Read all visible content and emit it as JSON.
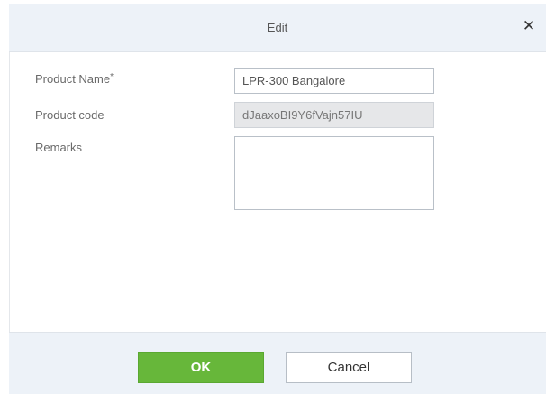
{
  "dialog": {
    "title": "Edit",
    "close_symbol": "✕"
  },
  "form": {
    "product_name": {
      "label": "Product Name",
      "required_marker": "*",
      "value": "LPR-300 Bangalore"
    },
    "product_code": {
      "label": "Product code",
      "value": "dJaaxoBI9Y6fVajn57IU"
    },
    "remarks": {
      "label": "Remarks",
      "value": ""
    }
  },
  "footer": {
    "ok_label": "OK",
    "cancel_label": "Cancel"
  },
  "colors": {
    "ok_button": "#67b73a",
    "header_bg": "#edf2f8"
  }
}
